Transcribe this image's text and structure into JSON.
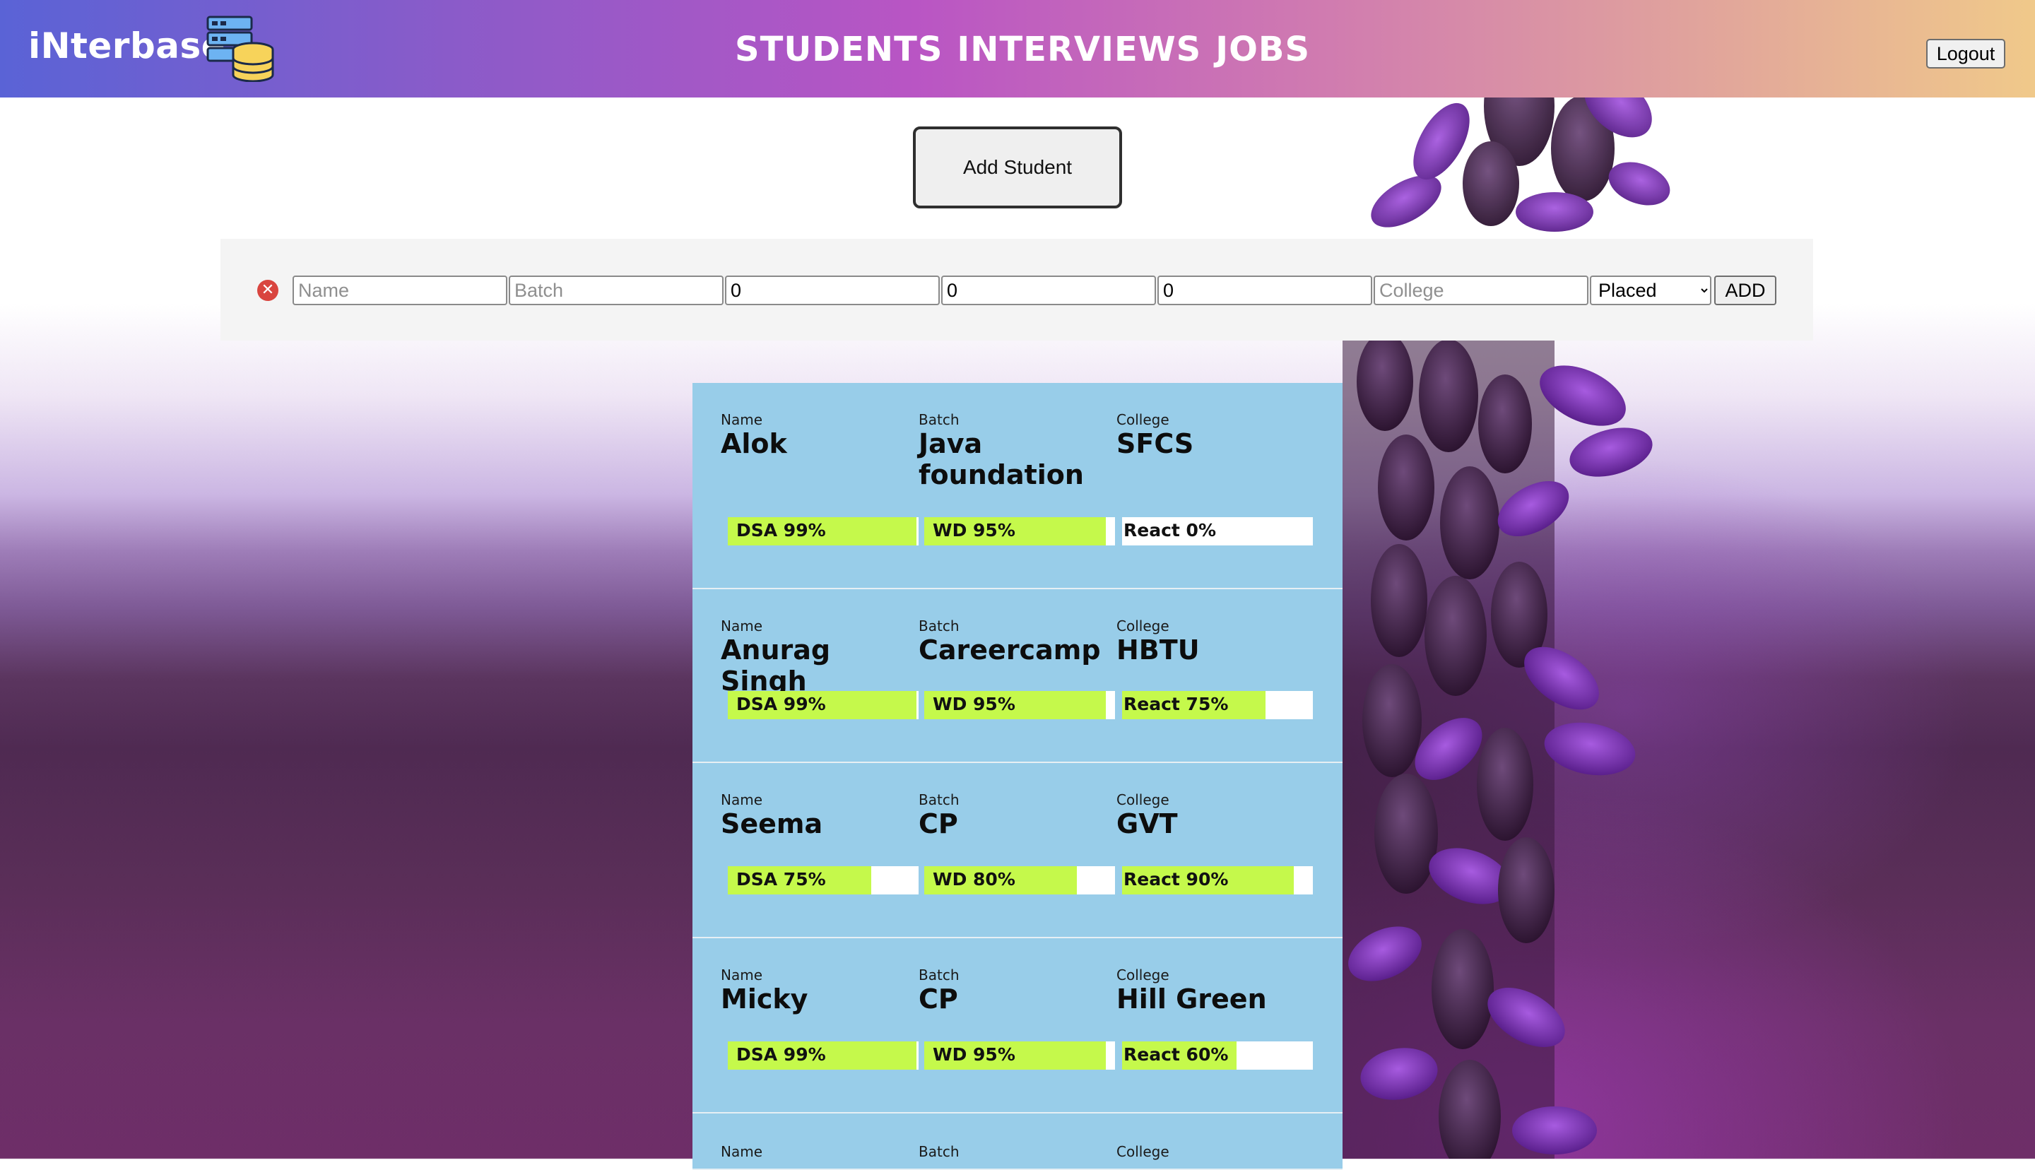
{
  "header": {
    "brand": "iNterbase",
    "logo_icon": "database-server-icon",
    "nav": [
      "STUDENTS",
      "INTERVIEWS",
      "JOBS"
    ],
    "logout_label": "Logout",
    "gradient": [
      "#5a63d6",
      "#b955c4",
      "#f0c98a"
    ]
  },
  "main": {
    "add_student_label": "Add Student"
  },
  "form": {
    "close_icon": "close-circle-icon",
    "name_placeholder": "Name",
    "batch_placeholder": "Batch",
    "score1_value": "0",
    "score2_value": "0",
    "score3_value": "0",
    "college_placeholder": "College",
    "status_selected": "Placed",
    "add_label": "ADD"
  },
  "labels": {
    "name": "Name",
    "batch": "Batch",
    "college": "College"
  },
  "students": [
    {
      "name": "Alok",
      "batch": "Java foundation",
      "college": "SFCS",
      "scores": [
        {
          "label": "DSA 99%",
          "value": 99
        },
        {
          "label": "WD 95%",
          "value": 95
        },
        {
          "label": "React 0%",
          "value": 0
        }
      ]
    },
    {
      "name": "Anurag Singh",
      "batch": "Careercamp",
      "college": "HBTU",
      "scores": [
        {
          "label": "DSA 99%",
          "value": 99
        },
        {
          "label": "WD 95%",
          "value": 95
        },
        {
          "label": "React 75%",
          "value": 75
        }
      ]
    },
    {
      "name": "Seema",
      "batch": "CP",
      "college": "GVT",
      "scores": [
        {
          "label": "DSA 75%",
          "value": 75
        },
        {
          "label": "WD 80%",
          "value": 80
        },
        {
          "label": "React 90%",
          "value": 90
        }
      ]
    },
    {
      "name": "Micky",
      "batch": "CP",
      "college": "Hill Green",
      "scores": [
        {
          "label": "DSA 99%",
          "value": 99
        },
        {
          "label": "WD 95%",
          "value": 95
        },
        {
          "label": "React 60%",
          "value": 60
        }
      ]
    },
    {
      "name": "",
      "batch": "",
      "college": "",
      "scores": []
    }
  ],
  "colors": {
    "card_bg": "#98cde9",
    "progress_fill": "#c5f94b",
    "close_red": "#d9453f"
  }
}
